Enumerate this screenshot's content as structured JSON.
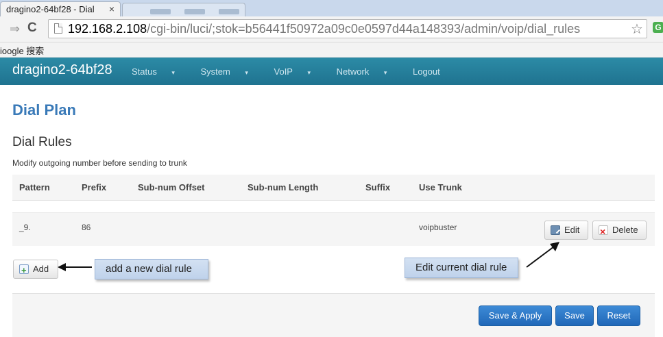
{
  "browser": {
    "tab_title": "dragino2-64bf28 - Dial",
    "tab_close": "×",
    "url_host": "192.168.2.108",
    "url_path": "/cgi-bin/luci/;stok=b56441f50972a09c0e0597d44a148393/admin/voip/dial_rules",
    "bookmark": "ioogle 搜索"
  },
  "navbar": {
    "brand": "dragino2-64bf28",
    "menu": [
      "Status",
      "System",
      "VoIP",
      "Network",
      "Logout"
    ]
  },
  "page": {
    "title": "Dial Plan",
    "section_title": "Dial Rules",
    "section_desc": "Modify outgoing number before sending to trunk"
  },
  "table": {
    "headers": [
      "Pattern",
      "Prefix",
      "Sub-num Offset",
      "Sub-num Length",
      "Suffix",
      "Use Trunk"
    ],
    "rows": [
      {
        "pattern": "_9.",
        "prefix": "86",
        "offset": "",
        "length": "",
        "suffix": "",
        "trunk": "voipbuster"
      }
    ],
    "edit_label": "Edit",
    "delete_label": "Delete"
  },
  "add_label": "Add",
  "annotations": {
    "add_note": "add a new dial rule",
    "edit_note": "Edit current dial rule"
  },
  "actions": {
    "save_apply": "Save & Apply",
    "save": "Save",
    "reset": "Reset"
  },
  "colors": {
    "navbar": "#2c8ba6",
    "title": "#3a7ab8",
    "primary_button": "#2168b8"
  }
}
